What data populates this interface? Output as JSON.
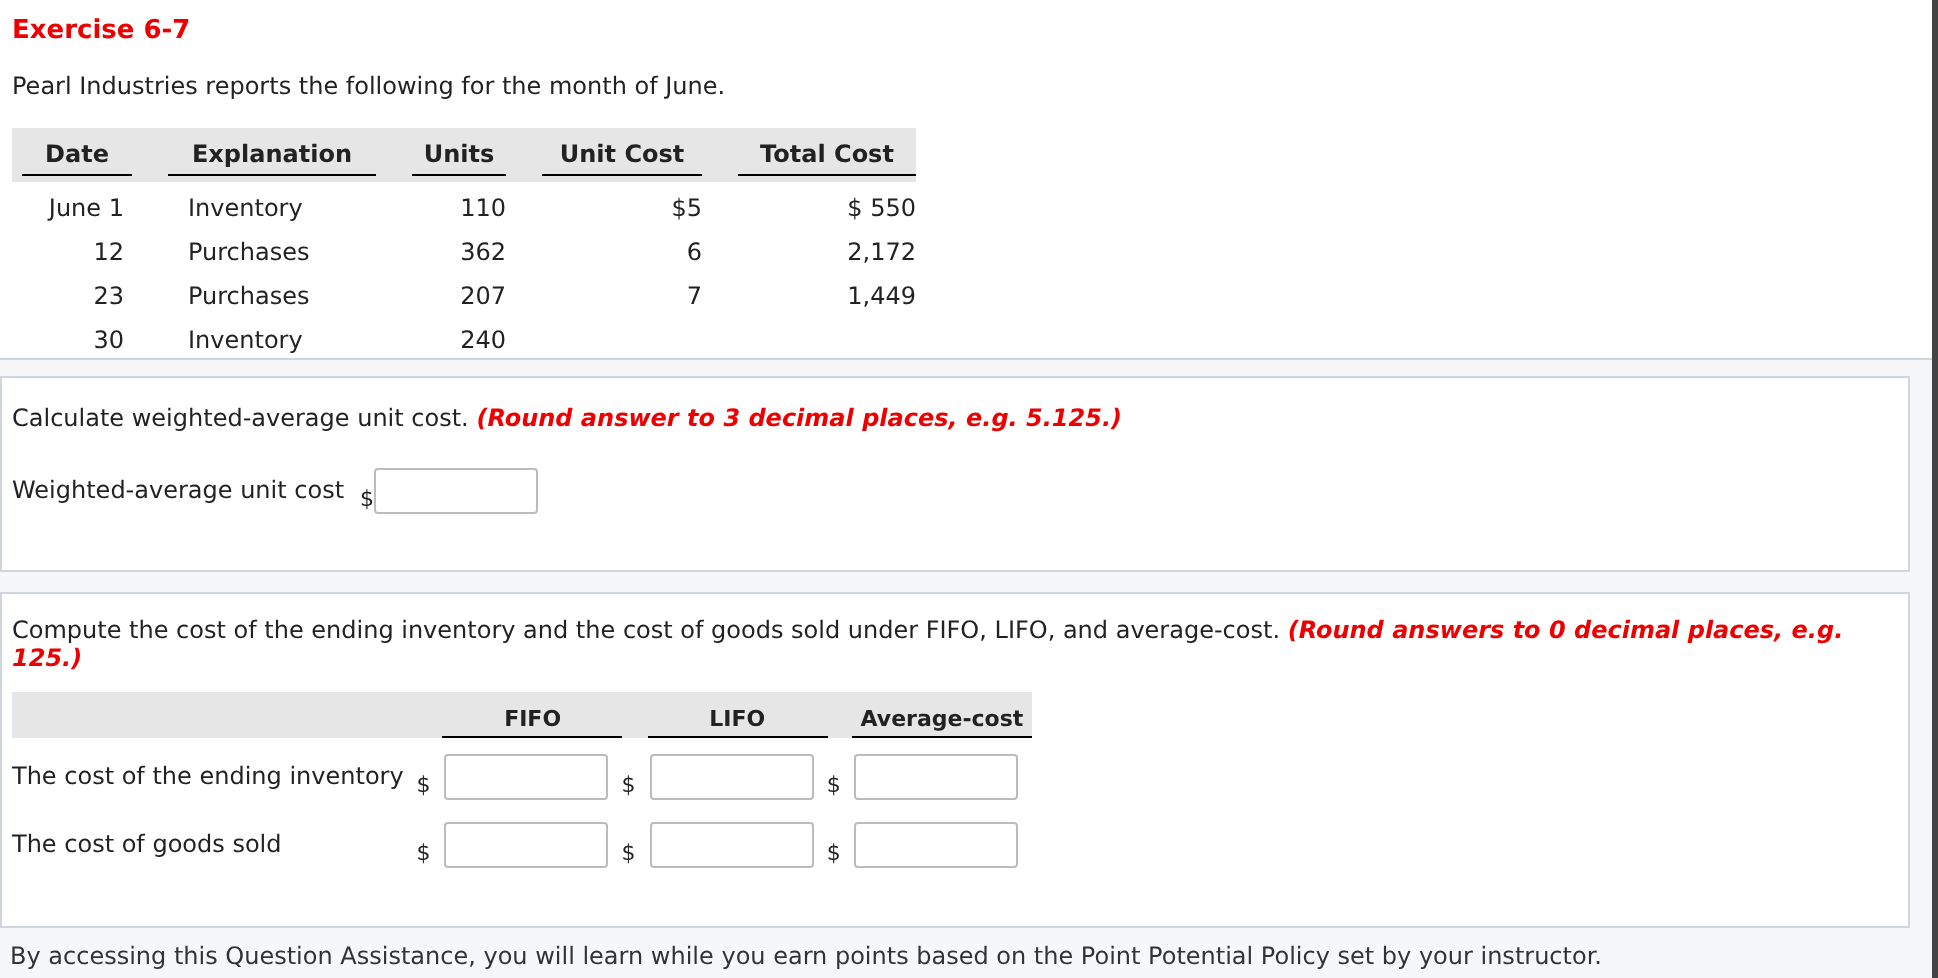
{
  "title": "Exercise 6-7",
  "intro": "Pearl Industries reports the following for the month of June.",
  "table": {
    "columns": [
      "Date",
      "Explanation",
      "Units",
      "Unit Cost",
      "Total Cost"
    ],
    "rows": [
      [
        "June 1",
        "Inventory",
        "110",
        "$5",
        "$ 550"
      ],
      [
        "12",
        "Purchases",
        "362",
        "6",
        "2,172"
      ],
      [
        "23",
        "Purchases",
        "207",
        "7",
        "1,449"
      ],
      [
        "30",
        "Inventory",
        "240",
        "",
        ""
      ]
    ]
  },
  "question_1": {
    "prompt": "Calculate weighted-average unit cost.",
    "hint": "(Round answer to 3 decimal places, e.g. 5.125.)",
    "field": {
      "label": "Weighted-average unit cost",
      "currency": "$"
    }
  },
  "question_2": {
    "prompt": "Compute the cost of the ending inventory and the cost of goods sold under FIFO, LIFO, and average-cost.",
    "hint": "(Round answers to 0 decimal places, e.g. 125.)",
    "columns": [
      "FIFO",
      "LIFO",
      "Average-cost"
    ],
    "rows": [
      {
        "label": "The cost of the ending inventory",
        "currencies": [
          "$",
          "$",
          "$"
        ]
      },
      {
        "label": "The cost of goods sold",
        "currencies": [
          "$",
          "$",
          "$"
        ]
      }
    ]
  },
  "footer_text": "By accessing this Question Assistance, you will learn while you earn points based on the Point Potential Policy set by your instructor."
}
